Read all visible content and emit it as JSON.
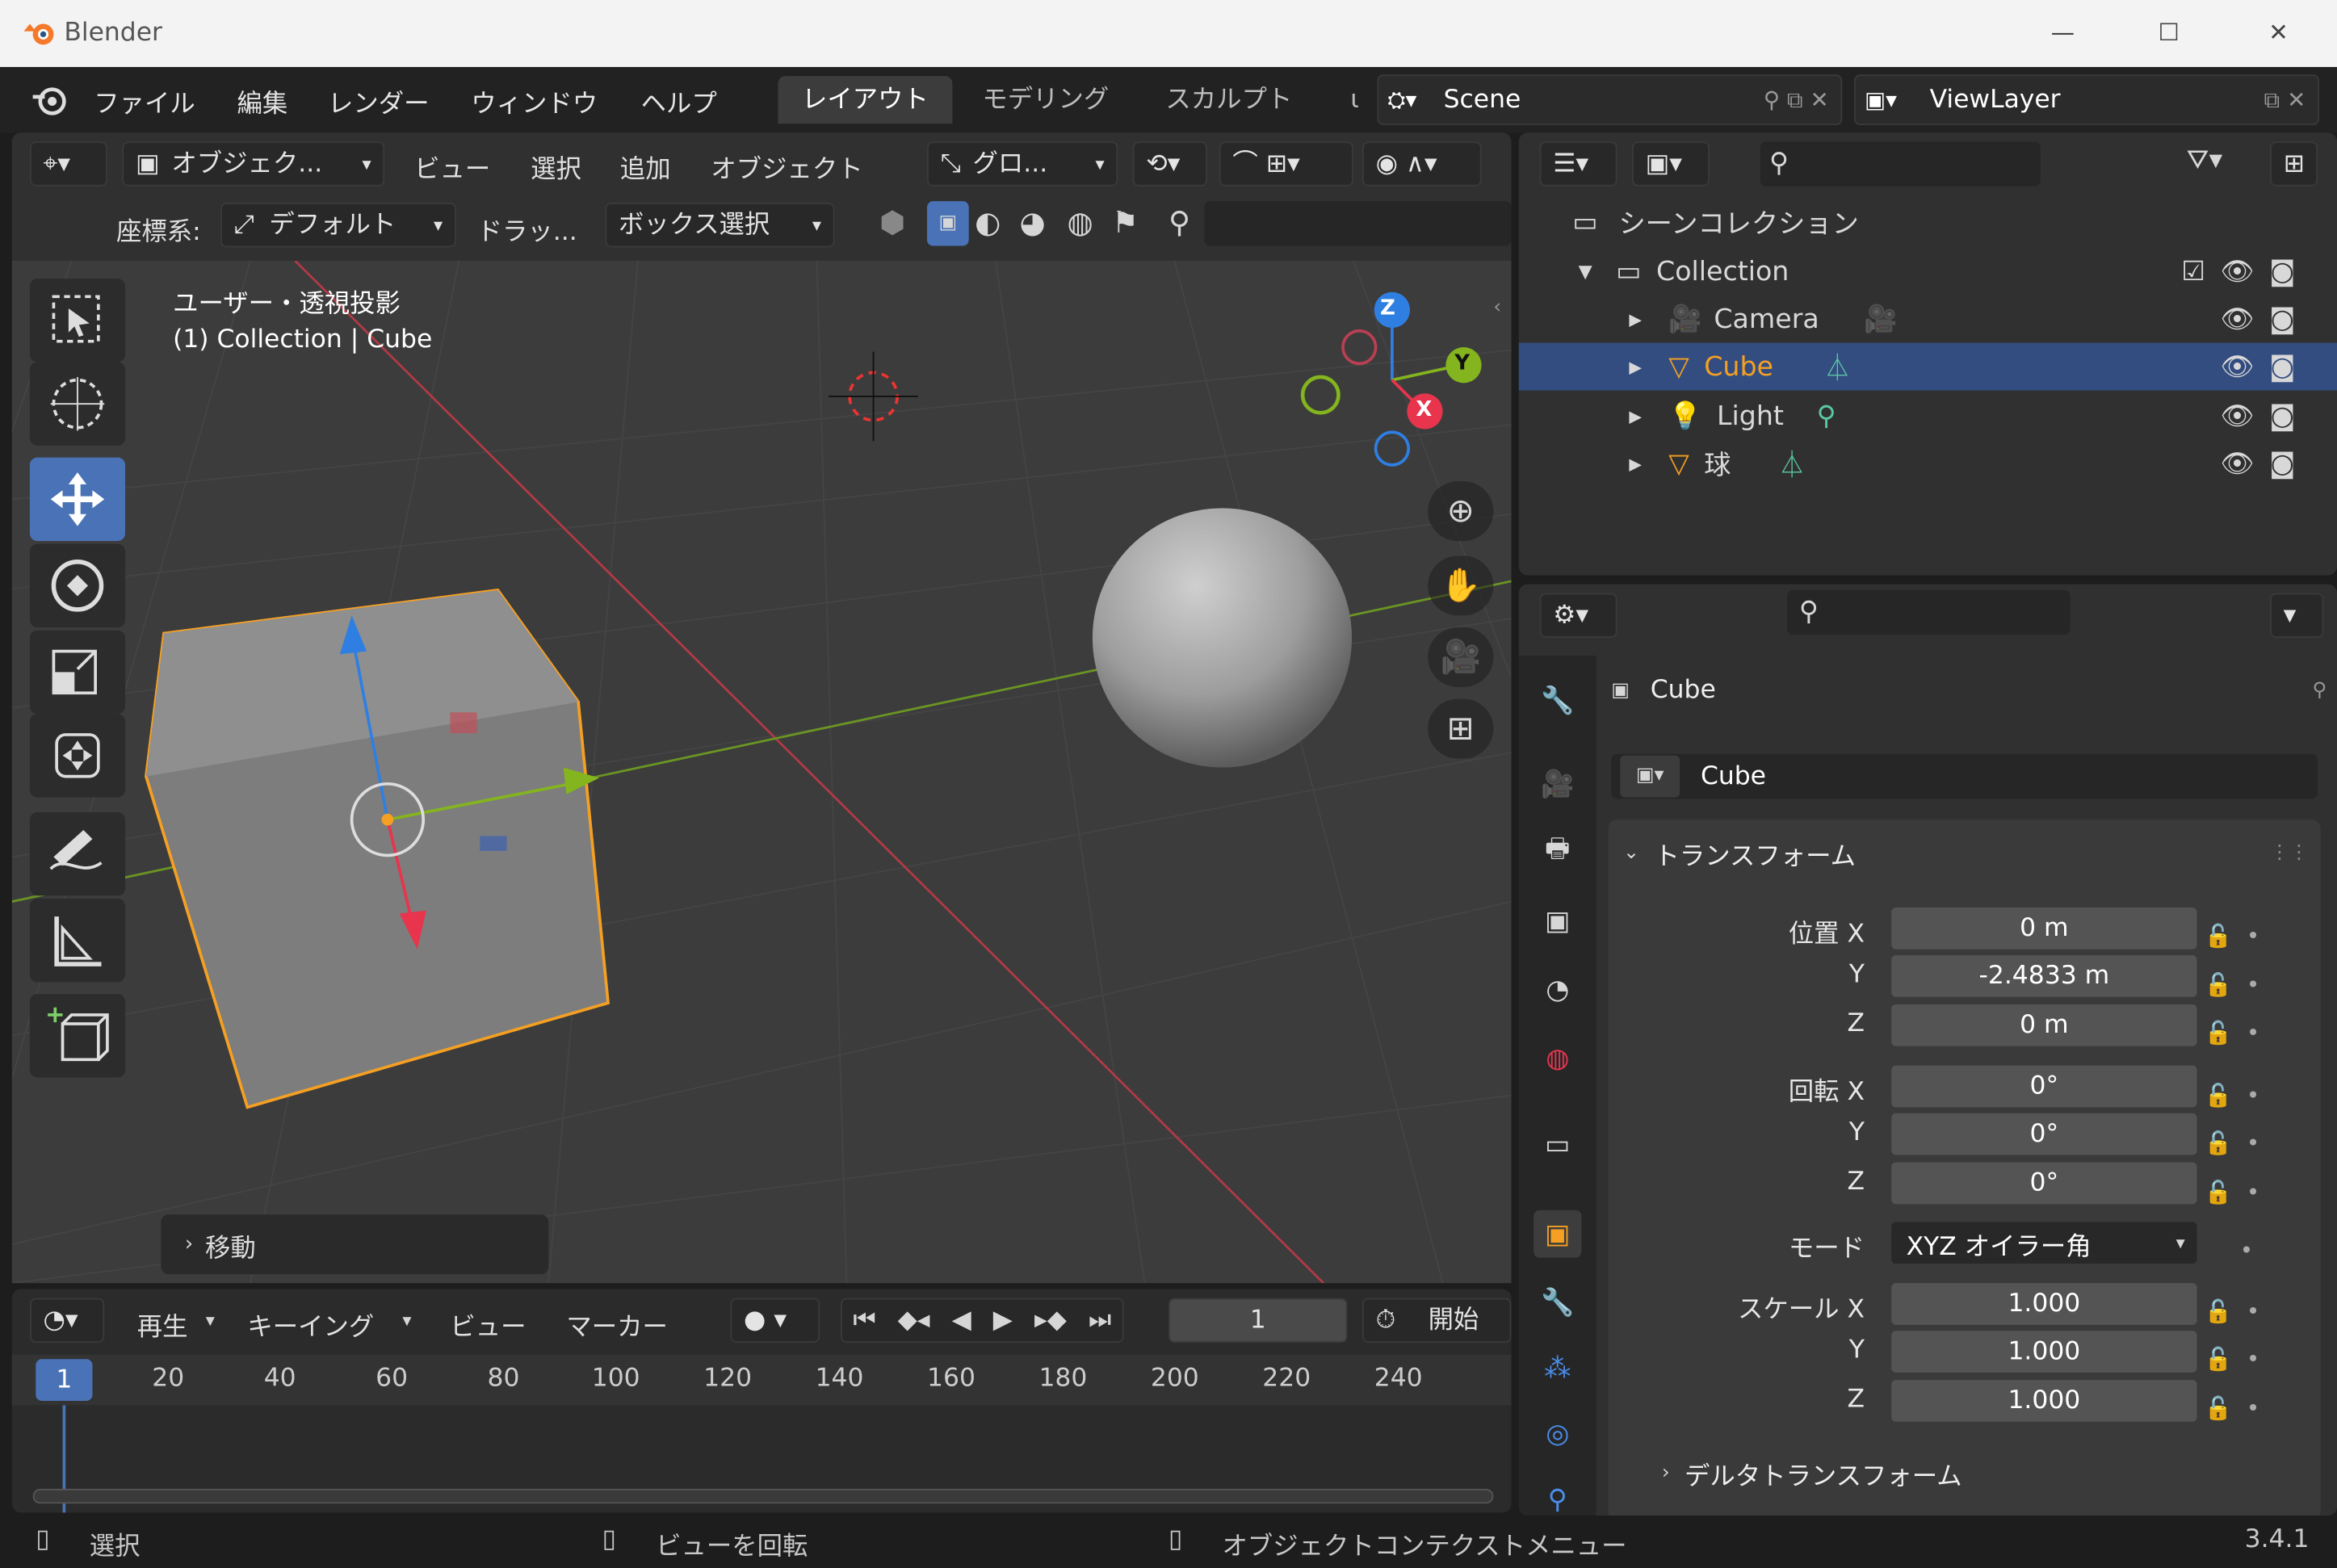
{
  "window": {
    "title": "Blender"
  },
  "menu": {
    "items": [
      "ファイル",
      "編集",
      "レンダー",
      "ウィンドウ",
      "ヘルプ"
    ]
  },
  "workspace_tabs": [
    {
      "label": "レイアウト",
      "active": true
    },
    {
      "label": "モデリング"
    },
    {
      "label": "スカルプト"
    },
    {
      "label": "ι"
    }
  ],
  "scene": {
    "name": "Scene"
  },
  "view_layer": {
    "name": "ViewLayer"
  },
  "viewport_header": {
    "mode": "オブジェク...",
    "menus": [
      "ビュー",
      "選択",
      "追加",
      "オブジェクト"
    ],
    "transform_orientation": "グロ...",
    "coord_label": "座標系:",
    "coord_value": "デフォルト",
    "drag_label": "ドラッ...",
    "select_mode": "ボックス選択"
  },
  "viewport": {
    "view_name": "ユーザー・透視投影",
    "collection_info": "(1) Collection | Cube",
    "gizmo": {
      "z": "Z",
      "y": "Y",
      "x": "X"
    },
    "last_operator": "移動"
  },
  "timeline": {
    "playback": "再生",
    "keying": "キーイング",
    "view": "ビュー",
    "marker": "マーカー",
    "current_frame": "1",
    "start_label": "開始",
    "ruler": [
      "1",
      "20",
      "40",
      "60",
      "80",
      "100",
      "120",
      "140",
      "160",
      "180",
      "200",
      "220",
      "240"
    ]
  },
  "outliner": {
    "scene_collection": "シーンコレクション",
    "collection": "Collection",
    "items": [
      {
        "name": "Camera",
        "selected": false
      },
      {
        "name": "Cube",
        "selected": true
      },
      {
        "name": "Light",
        "selected": false
      },
      {
        "name": "球",
        "selected": false
      }
    ]
  },
  "properties": {
    "object_name": "Cube",
    "object_field": "Cube",
    "transform_label": "トランスフォーム",
    "location_label": "位置 X",
    "location": [
      "0 m",
      "-2.4833 m",
      "0 m"
    ],
    "rotation_label": "回転 X",
    "rotation": [
      "0°",
      "0°",
      "0°"
    ],
    "mode_label": "モード",
    "mode_value": "XYZ オイラー角",
    "scale_label": "スケール X",
    "scale": [
      "1.000",
      "1.000",
      "1.000"
    ],
    "axis_y": "Y",
    "axis_z": "Z",
    "delta_label": "デルタトランスフォーム"
  },
  "statusbar": {
    "select": "選択",
    "rotate": "ビューを回転",
    "context_menu": "オブジェクトコンテクストメニュー",
    "version": "3.4.1"
  },
  "colors": {
    "accent": "#4a73b7",
    "selection": "#334d80",
    "orange": "#f5a023",
    "x_axis": "#e8344d",
    "y_axis": "#84b41e",
    "z_axis": "#2f7fe3"
  }
}
